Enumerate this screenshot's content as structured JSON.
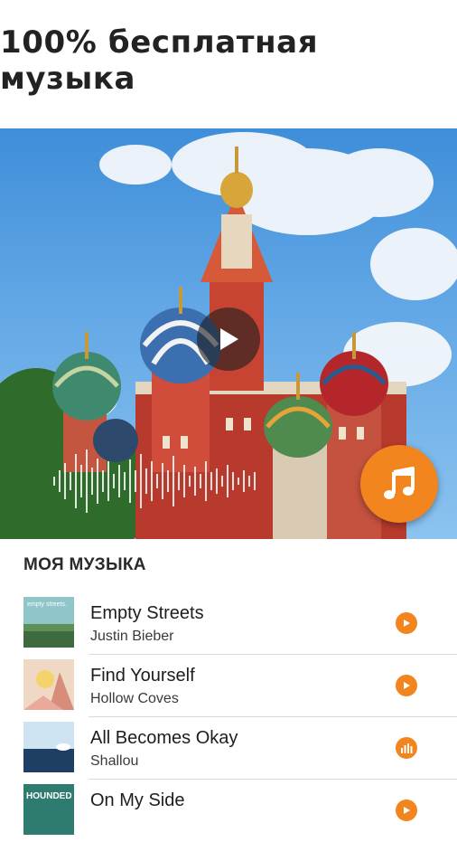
{
  "header": {
    "title": "100% бесплатная музыка"
  },
  "hero": {
    "play_icon": "play-icon",
    "fab_icon": "music-note-icon",
    "accent": "#f3851f"
  },
  "section": {
    "title": "МОЯ МУЗЫКА"
  },
  "tracks": [
    {
      "title": "Empty Streets",
      "artist": "Justin Bieber",
      "state": "play",
      "thumb_text": "empty streets."
    },
    {
      "title": "Find Yourself",
      "artist": "Hollow  Coves",
      "state": "play"
    },
    {
      "title": "All Becomes Okay",
      "artist": "Shallou",
      "state": "playing"
    },
    {
      "title": "On My Side",
      "artist": "",
      "state": "play",
      "thumb_text": "HOUNDED"
    }
  ]
}
